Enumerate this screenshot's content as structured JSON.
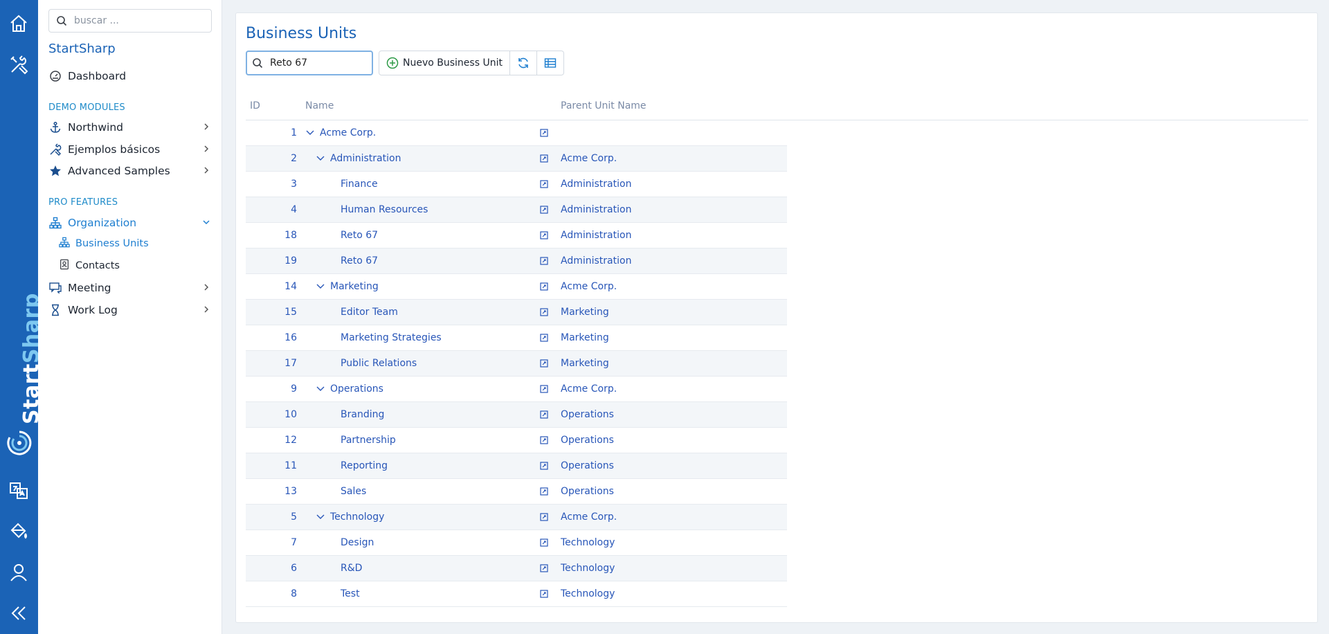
{
  "sidebar": {
    "search_placeholder": "buscar ...",
    "app_title": "StartSharp",
    "dashboard": "Dashboard",
    "section_demo": "DEMO MODULES",
    "northwind": "Northwind",
    "ejemplos": "Ejemplos básicos",
    "advanced": "Advanced Samples",
    "section_pro": "PRO FEATURES",
    "organization": "Organization",
    "business_units": "Business Units",
    "contacts": "Contacts",
    "meeting": "Meeting",
    "work_log": "Work Log"
  },
  "rail": {
    "brand_start": "Start",
    "brand_sharp": "Sharp"
  },
  "page": {
    "title": "Business Units",
    "quick_search_value": "Reto 67",
    "new_button": "Nuevo Business Unit"
  },
  "grid": {
    "headers": {
      "id": "ID",
      "name": "Name",
      "parent": "Parent Unit Name"
    },
    "rows": [
      {
        "id": "1",
        "name": "Acme Corp.",
        "parent": "",
        "level": 0,
        "expander": true
      },
      {
        "id": "2",
        "name": "Administration",
        "parent": "Acme Corp.",
        "level": 1,
        "expander": true
      },
      {
        "id": "3",
        "name": "Finance",
        "parent": "Administration",
        "level": 2,
        "expander": false
      },
      {
        "id": "4",
        "name": "Human Resources",
        "parent": "Administration",
        "level": 2,
        "expander": false
      },
      {
        "id": "18",
        "name": "Reto 67",
        "parent": "Administration",
        "level": 2,
        "expander": false
      },
      {
        "id": "19",
        "name": "Reto 67",
        "parent": "Administration",
        "level": 2,
        "expander": false
      },
      {
        "id": "14",
        "name": "Marketing",
        "parent": "Acme Corp.",
        "level": 1,
        "expander": true
      },
      {
        "id": "15",
        "name": "Editor Team",
        "parent": "Marketing",
        "level": 2,
        "expander": false
      },
      {
        "id": "16",
        "name": "Marketing Strategies",
        "parent": "Marketing",
        "level": 2,
        "expander": false
      },
      {
        "id": "17",
        "name": "Public Relations",
        "parent": "Marketing",
        "level": 2,
        "expander": false
      },
      {
        "id": "9",
        "name": "Operations",
        "parent": "Acme Corp.",
        "level": 1,
        "expander": true
      },
      {
        "id": "10",
        "name": "Branding",
        "parent": "Operations",
        "level": 2,
        "expander": false
      },
      {
        "id": "12",
        "name": "Partnership",
        "parent": "Operations",
        "level": 2,
        "expander": false
      },
      {
        "id": "11",
        "name": "Reporting",
        "parent": "Operations",
        "level": 2,
        "expander": false
      },
      {
        "id": "13",
        "name": "Sales",
        "parent": "Operations",
        "level": 2,
        "expander": false
      },
      {
        "id": "5",
        "name": "Technology",
        "parent": "Acme Corp.",
        "level": 1,
        "expander": true
      },
      {
        "id": "7",
        "name": "Design",
        "parent": "Technology",
        "level": 2,
        "expander": false
      },
      {
        "id": "6",
        "name": "R&D",
        "parent": "Technology",
        "level": 2,
        "expander": false
      },
      {
        "id": "8",
        "name": "Test",
        "parent": "Technology",
        "level": 2,
        "expander": false
      }
    ]
  },
  "colors": {
    "rail": "#1b63b6",
    "accent": "#1f7fd0",
    "link": "#2856b8"
  },
  "icons": {
    "rail": [
      "home-icon",
      "tools-icon",
      "translate-icon",
      "paint-bucket-icon",
      "user-icon",
      "collapse-icon"
    ],
    "row_edit": "edit-icon",
    "toolbar": [
      "plus-circle-icon",
      "refresh-icon",
      "column-picker-icon"
    ]
  }
}
